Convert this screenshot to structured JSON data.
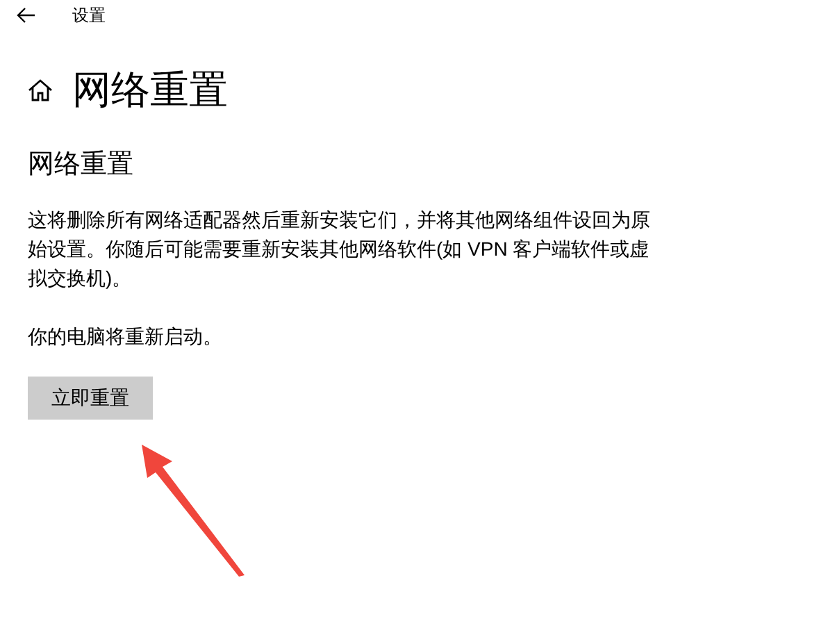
{
  "window": {
    "title": "设置"
  },
  "page": {
    "title": "网络重置"
  },
  "section": {
    "title": "网络重置",
    "description": "这将删除所有网络适配器然后重新安装它们，并将其他网络组件设回为原始设置。你随后可能需要重新安装其他网络软件(如 VPN 客户端软件或虚拟交换机)。",
    "note": "你的电脑将重新启动。",
    "button": "立即重置"
  }
}
